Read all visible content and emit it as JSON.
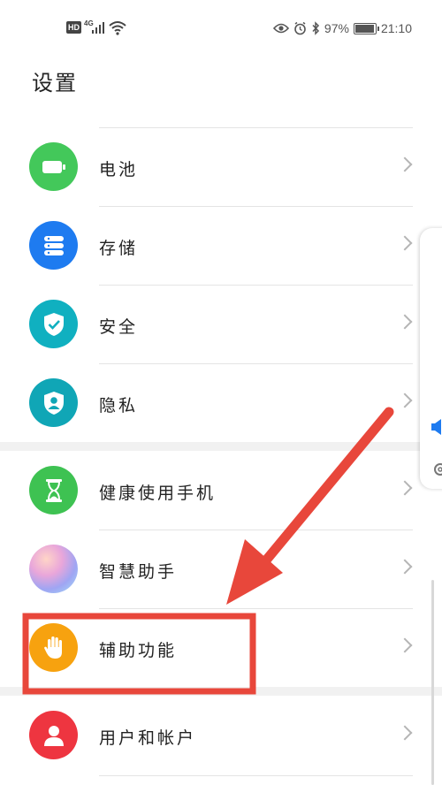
{
  "status_bar": {
    "hd": "HD",
    "network": "4G",
    "battery_percent": "97%",
    "time": "21:10"
  },
  "page": {
    "title": "设置"
  },
  "settings": {
    "items": [
      {
        "label": "电池",
        "icon": "battery-icon",
        "color": "#43C85A"
      },
      {
        "label": "存储",
        "icon": "storage-icon",
        "color": "#1E7BF0"
      },
      {
        "label": "安全",
        "icon": "security-shield-icon",
        "color": "#10B0C0"
      },
      {
        "label": "隐私",
        "icon": "privacy-shield-icon",
        "color": "#10A6B6"
      },
      {
        "label": "健康使用手机",
        "icon": "hourglass-icon",
        "color": "#3EC252"
      },
      {
        "label": "智慧助手",
        "icon": "assistant-icon",
        "color": "#B7A2EE"
      },
      {
        "label": "辅助功能",
        "icon": "hand-icon",
        "color": "#F7A20F"
      },
      {
        "label": "用户和帐户",
        "icon": "user-icon",
        "color": "#EE3540"
      }
    ]
  },
  "annotation": {
    "color": "#E8473B"
  }
}
